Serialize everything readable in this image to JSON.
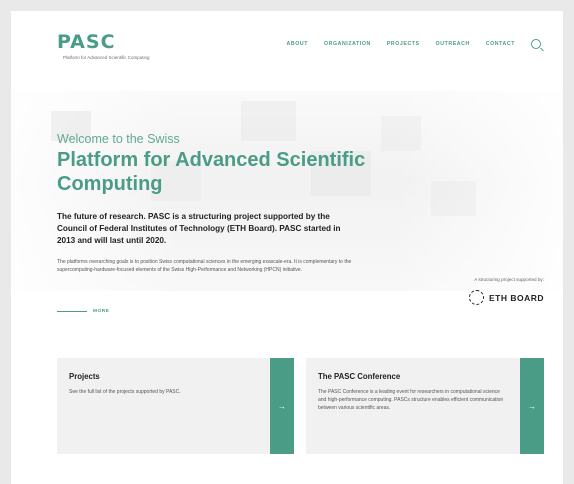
{
  "brand": {
    "logo_text": "PASC",
    "tagline": "Platform for Advanced Scientific Computing"
  },
  "nav": {
    "items": [
      "ABOUT",
      "ORGANIZATION",
      "PROJECTS",
      "OUTREACH",
      "CONTACT"
    ],
    "search_icon": "search-icon"
  },
  "hero": {
    "welcome": "Welcome to the Swiss",
    "headline": "Platform for Advanced Scientific Computing",
    "lead": "The future of research. PASC is a structuring project supported by the Council of Federal Institutes of Technology (ETH Board). PASC started in 2013 and will last until 2020.",
    "body": "The platforms overarching goals is to position Swiss computational sciences in the emerging exascale-era. It is complementary to the supercomputing-hardware-focused elements of the Swiss High-Performance and Networking (HPCN) initiative.",
    "more_label": "MORE"
  },
  "eth": {
    "caption": "A structuring project supported by:",
    "label": "ETH BOARD"
  },
  "cards": [
    {
      "title": "Projects",
      "text": "See the full list of the projects supported by PASC.",
      "arrow": "→"
    },
    {
      "title": "The PASC Conference",
      "text": "The PASC Conference is a leading event for researchers in computational science and high-performance computing. PASCs structure enables efficient communication between various scientific areas.",
      "arrow": "→"
    }
  ],
  "colors": {
    "accent": "#4a9c86",
    "card_bg": "#f1f1f1",
    "text": "#222222"
  }
}
